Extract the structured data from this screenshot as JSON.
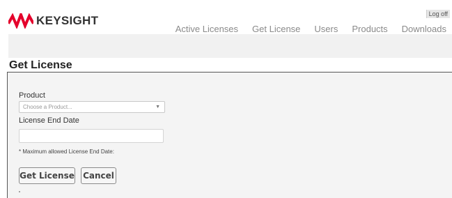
{
  "brand": {
    "name": "KEYSIGHT",
    "logo_color": "#e4002b"
  },
  "header": {
    "logoff_label": "Log off"
  },
  "nav": {
    "items": [
      "Active Licenses",
      "Get License",
      "Users",
      "Products",
      "Downloads"
    ]
  },
  "page": {
    "title": "Get License"
  },
  "form": {
    "product_label": "Product",
    "product_placeholder": "Choose a Product...",
    "end_date_label": "License End Date",
    "end_date_value": "",
    "max_date_note": "* Maximum allowed License End Date:",
    "get_license_label": "Get License",
    "cancel_label": "Cancel"
  },
  "icons": {
    "logo": "keysight-wave-logo-icon",
    "dropdown": "chevron-down-icon"
  }
}
